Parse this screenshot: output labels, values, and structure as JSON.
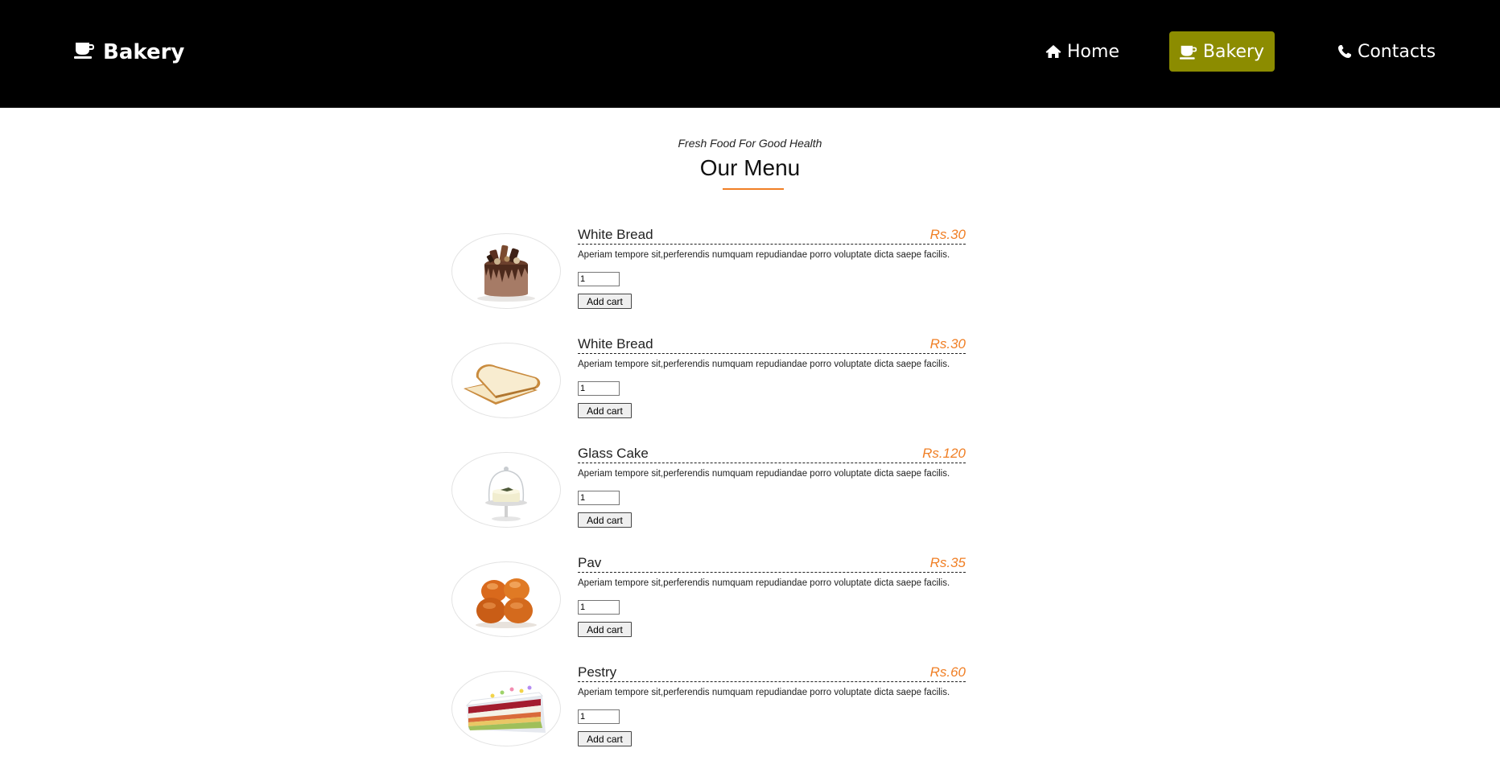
{
  "navbar": {
    "brand": "Bakery",
    "links": [
      {
        "label": "Home",
        "icon": "home-icon"
      },
      {
        "label": "Bakery",
        "icon": "coffee-cup-icon"
      },
      {
        "label": "Contacts",
        "icon": "phone-icon"
      }
    ],
    "active_color": "#8c8c00"
  },
  "heading": {
    "subtitle": "Fresh Food For Good Health",
    "title": "Our Menu",
    "accent": "#f07f25"
  },
  "menu": {
    "add_label": "Add cart",
    "items": [
      {
        "name": "White Bread",
        "price": "Rs.30",
        "desc": "Aperiam tempore sit,perferendis numquam repudiandae porro voluptate dicta saepe facilis.",
        "qty": "1",
        "image": "chocolate-cake"
      },
      {
        "name": "White Bread",
        "price": "Rs.30",
        "desc": "Aperiam tempore sit,perferendis numquam repudiandae porro voluptate dicta saepe facilis.",
        "qty": "1",
        "image": "bread-slices"
      },
      {
        "name": "Glass Cake",
        "price": "Rs.120",
        "desc": "Aperiam tempore sit,perferendis numquam repudiandae porro voluptate dicta saepe facilis.",
        "qty": "1",
        "image": "glass-cake"
      },
      {
        "name": "Pav",
        "price": "Rs.35",
        "desc": "Aperiam tempore sit,perferendis numquam repudiandae porro voluptate dicta saepe facilis.",
        "qty": "1",
        "image": "pav-buns"
      },
      {
        "name": "Pestry",
        "price": "Rs.60",
        "desc": "Aperiam tempore sit,perferendis numquam repudiandae porro voluptate dicta saepe facilis.",
        "qty": "1",
        "image": "pastry-slice"
      }
    ]
  }
}
